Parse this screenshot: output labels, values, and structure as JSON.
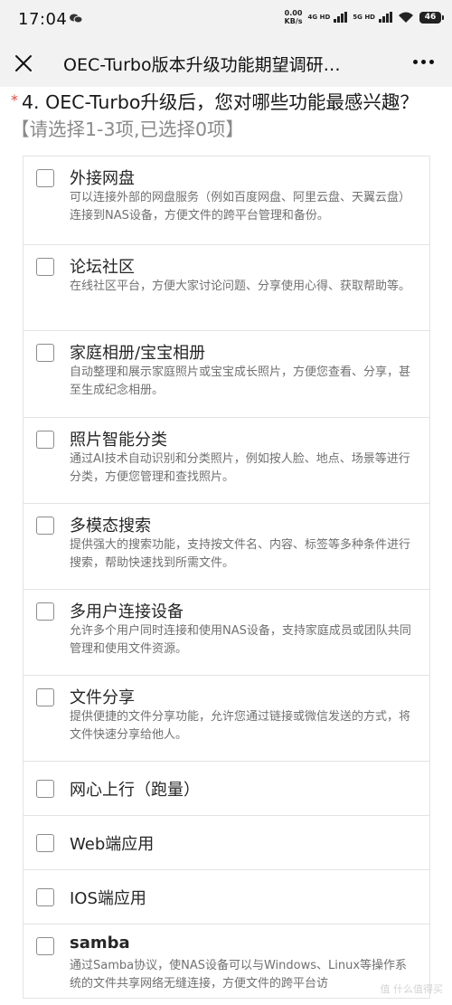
{
  "status_bar": {
    "time": "17:04",
    "net_speed": "0.00",
    "net_unit": "KB/s",
    "network_1": "4G HD",
    "network_2": "5G HD",
    "battery": "46"
  },
  "nav": {
    "title": "OEC-Turbo版本升级功能期望调研…"
  },
  "question": {
    "required_mark": "*",
    "text": "4. OEC-Turbo升级后，您对哪些功能最感兴趣？",
    "hint": "【请选择1-3项,已选择0项】"
  },
  "options": [
    {
      "title": "外接网盘",
      "desc": "可以连接外部的网盘服务（例如百度网盘、阿里云盘、天翼云盘）连接到NAS设备，方便文件的跨平台管理和备份。",
      "checked": false
    },
    {
      "title": "论坛社区",
      "desc": "在线社区平台，方便大家讨论问题、分享使用心得、获取帮助等。",
      "checked": false
    },
    {
      "title": "家庭相册/宝宝相册",
      "desc": "自动整理和展示家庭照片或宝宝成长照片，方便您查看、分享，甚至生成纪念相册。",
      "checked": false
    },
    {
      "title": "照片智能分类",
      "desc": "通过AI技术自动识别和分类照片，例如按人脸、地点、场景等进行分类，方便您管理和查找照片。",
      "checked": false
    },
    {
      "title": "多模态搜索",
      "desc": "提供强大的搜索功能，支持按文件名、内容、标签等多种条件进行搜索，帮助快速找到所需文件。",
      "checked": false
    },
    {
      "title": "多用户连接设备",
      "desc": "允许多个用户同时连接和使用NAS设备，支持家庭成员或团队共同管理和使用文件资源。",
      "checked": false
    },
    {
      "title": "文件分享",
      "desc": "提供便捷的文件分享功能，允许您通过链接或微信发送的方式，将文件快速分享给他人。",
      "checked": false
    },
    {
      "title": "网心上行（跑量）",
      "desc": "",
      "checked": false
    },
    {
      "title": "Web端应用",
      "desc": "",
      "checked": false
    },
    {
      "title": "IOS端应用",
      "desc": "",
      "checked": false
    },
    {
      "title": "samba",
      "desc": "通过Samba协议，使NAS设备可以与Windows、Linux等操作系统的文件共享网络无缝连接，方便文件的跨平台访",
      "checked": false
    }
  ],
  "watermark": "值 什么值得买"
}
